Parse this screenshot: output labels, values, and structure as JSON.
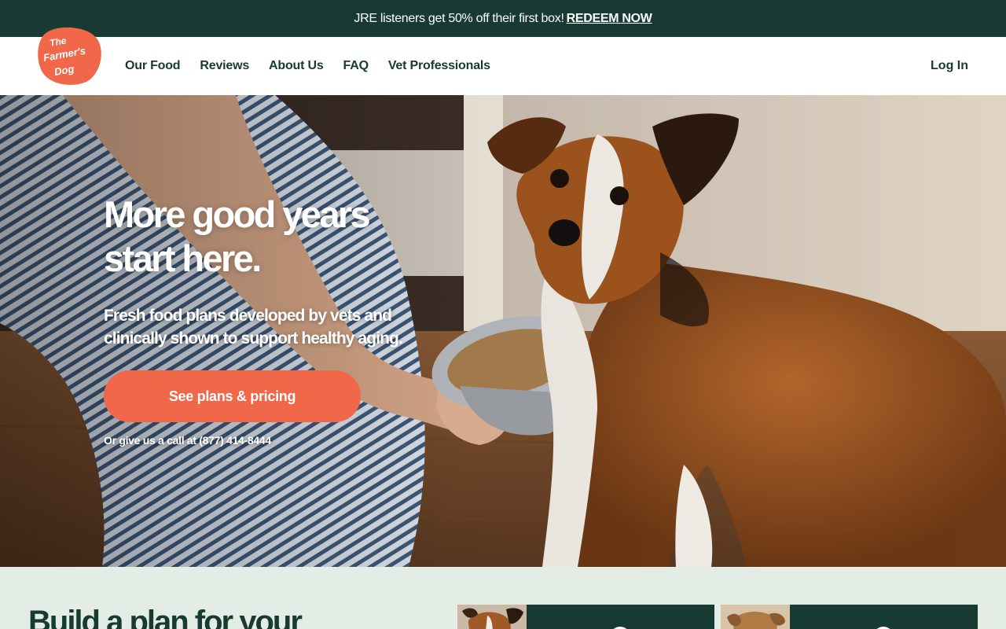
{
  "promo": {
    "text": "JRE listeners get 50% off their first box!",
    "link": "REDEEM NOW"
  },
  "header": {
    "logo": {
      "line1": "The",
      "line2": "Farmer's",
      "line3": "Dog"
    },
    "nav": [
      "Our Food",
      "Reviews",
      "About Us",
      "FAQ",
      "Vet Professionals"
    ],
    "login": "Log In"
  },
  "hero": {
    "title_line1": "More good years",
    "title_line2": "start here.",
    "subtitle_line1": "Fresh food plans developed by vets and",
    "subtitle_line2": "clinically shown to support healthy aging.",
    "cta": "See plans & pricing",
    "call": "Or give us a call at (877) 414-8444"
  },
  "plan": {
    "title": "Build a plan for your"
  },
  "colors": {
    "brand_green": "#173b33",
    "accent_orange": "#f0674a",
    "mint_background": "#e3ede6"
  }
}
